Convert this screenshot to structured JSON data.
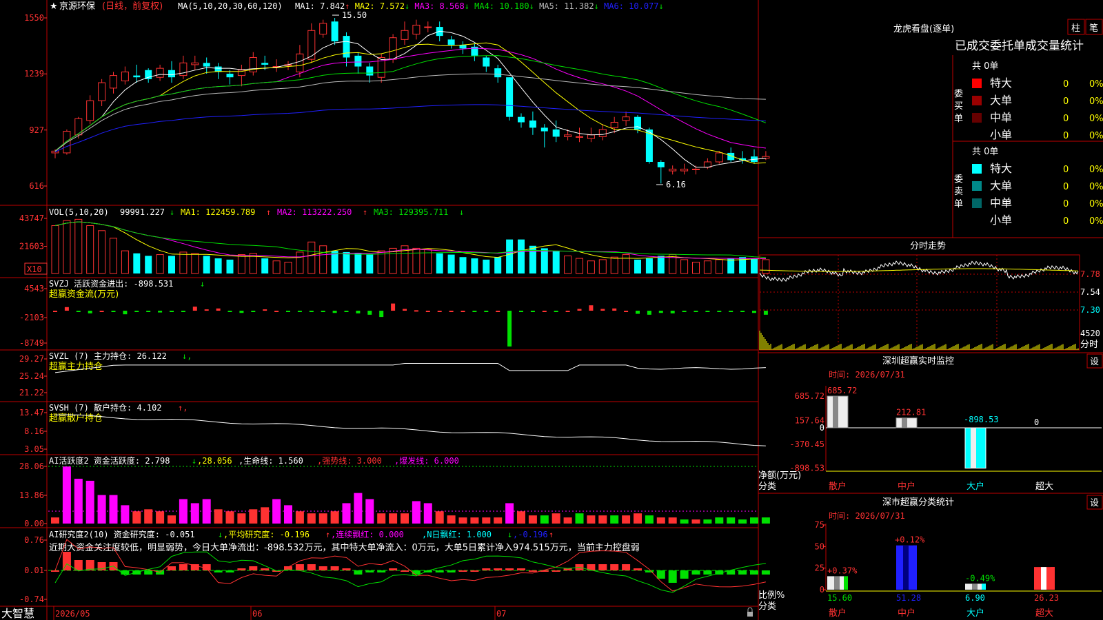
{
  "app": {
    "bottom_left": "大智慧",
    "bottom_right_icon": "lock-icon"
  },
  "colors": {
    "up": "#ff3232",
    "down": "#00ffff",
    "grid": "#c00000",
    "green": "#00e000",
    "yellow": "#ffff00",
    "magenta": "#ff00ff",
    "white": "#ffffff",
    "blue": "#2020ff",
    "grey": "#bbbbbb"
  },
  "main": {
    "title_star": "★",
    "stock_name": "京源环保",
    "period": "(日线，前复权)",
    "ma_label": "MA(5,10,20,30,60,120)",
    "mas": [
      {
        "label": "MA1:",
        "value": "7.842",
        "arrow": "↑",
        "color": "#ffffff"
      },
      {
        "label": "MA2:",
        "value": "7.572",
        "arrow": "↓",
        "color": "#ffff00"
      },
      {
        "label": "MA3:",
        "value": "8.568",
        "arrow": "↓",
        "color": "#ff00ff"
      },
      {
        "label": "MA4:",
        "value": "10.180",
        "arrow": "↓",
        "color": "#00e000"
      },
      {
        "label": "MA5:",
        "value": "11.382",
        "arrow": "↓",
        "color": "#bbbbbb"
      },
      {
        "label": "MA6:",
        "value": "10.077",
        "arrow": "↓",
        "color": "#2020ff"
      }
    ],
    "y_ticks": [
      "1550",
      "1239",
      "927",
      "616"
    ],
    "high_label": "15.50",
    "low_label": "6.16"
  },
  "chart_data": [
    {
      "type": "candlestick",
      "title": "京源环保(日线，前复权)",
      "x_labels": [
        "2026/05",
        "06",
        "07"
      ],
      "ylim": [
        5.3,
        15.6
      ],
      "y_ticks": [
        15.5,
        12.39,
        9.27,
        6.16
      ],
      "candles": [
        [
          8.0,
          8.1,
          7.7,
          8.2
        ],
        [
          8.0,
          9.2,
          7.9,
          9.3
        ],
        [
          9.0,
          9.9,
          8.8,
          10.0
        ],
        [
          9.8,
          10.9,
          9.6,
          11.2
        ],
        [
          10.9,
          11.9,
          10.6,
          12.1
        ],
        [
          11.6,
          12.3,
          11.3,
          12.5
        ],
        [
          12.0,
          12.5,
          11.8,
          12.8
        ],
        [
          12.3,
          12.2,
          11.9,
          12.9
        ],
        [
          12.6,
          12.1,
          11.9,
          12.7
        ],
        [
          12.2,
          12.7,
          12.0,
          12.9
        ],
        [
          12.6,
          12.2,
          11.9,
          13.1
        ],
        [
          12.3,
          13.0,
          12.1,
          13.4
        ],
        [
          12.9,
          13.0,
          12.6,
          13.4
        ],
        [
          13.0,
          12.8,
          12.4,
          13.3
        ],
        [
          12.8,
          12.5,
          12.1,
          13.0
        ],
        [
          12.4,
          12.2,
          11.8,
          12.6
        ],
        [
          12.3,
          12.6,
          11.7,
          12.9
        ],
        [
          12.5,
          13.3,
          12.3,
          13.6
        ],
        [
          13.0,
          12.9,
          12.6,
          13.4
        ],
        [
          12.8,
          12.8,
          12.5,
          13.2
        ],
        [
          12.9,
          12.9,
          12.6,
          13.1
        ],
        [
          12.5,
          13.5,
          12.2,
          14.0
        ],
        [
          13.2,
          14.8,
          13.0,
          15.2
        ],
        [
          14.6,
          15.2,
          14.4,
          15.4
        ],
        [
          15.3,
          14.2,
          14.0,
          15.5
        ],
        [
          14.5,
          13.3,
          12.8,
          14.7
        ],
        [
          13.4,
          12.8,
          12.4,
          13.6
        ],
        [
          12.8,
          12.3,
          11.9,
          13.0
        ],
        [
          12.2,
          13.3,
          11.9,
          13.5
        ],
        [
          13.2,
          14.4,
          13.0,
          14.6
        ],
        [
          14.3,
          14.8,
          14.0,
          15.3
        ],
        [
          14.6,
          15.1,
          14.3,
          15.4
        ],
        [
          15.0,
          15.0,
          14.7,
          15.3
        ],
        [
          15.0,
          14.5,
          14.2,
          15.3
        ],
        [
          14.3,
          14.0,
          13.8,
          14.5
        ],
        [
          14.0,
          13.8,
          13.5,
          14.2
        ],
        [
          13.9,
          13.4,
          13.1,
          14.1
        ],
        [
          13.3,
          12.8,
          12.5,
          13.4
        ],
        [
          12.7,
          12.2,
          11.9,
          12.9
        ],
        [
          12.2,
          10.0,
          9.8,
          12.2
        ],
        [
          10.0,
          9.7,
          9.4,
          10.2
        ],
        [
          9.8,
          9.4,
          9.0,
          10.3
        ],
        [
          9.4,
          9.2,
          8.3,
          9.6
        ],
        [
          9.3,
          8.9,
          8.6,
          9.8
        ],
        [
          8.9,
          9.0,
          8.7,
          9.3
        ],
        [
          8.9,
          8.9,
          8.6,
          9.4
        ],
        [
          8.8,
          9.0,
          8.6,
          9.4
        ],
        [
          8.9,
          9.3,
          8.7,
          9.6
        ],
        [
          9.4,
          9.7,
          9.1,
          10.0
        ],
        [
          9.8,
          10.0,
          9.5,
          10.3
        ],
        [
          10.0,
          9.3,
          9.1,
          10.1
        ],
        [
          9.3,
          7.5,
          7.4,
          9.4
        ],
        [
          7.5,
          7.2,
          6.3,
          7.6
        ],
        [
          7.0,
          7.1,
          6.8,
          7.3
        ],
        [
          7.0,
          7.1,
          6.8,
          7.4
        ],
        [
          7.1,
          7.1,
          6.8,
          7.3
        ],
        [
          7.2,
          7.5,
          7.1,
          7.7
        ],
        [
          7.5,
          8.0,
          7.4,
          8.1
        ],
        [
          8.0,
          7.6,
          7.5,
          8.3
        ],
        [
          7.7,
          7.6,
          7.4,
          8.1
        ],
        [
          7.8,
          7.5,
          7.4,
          8.2
        ],
        [
          7.7,
          7.8,
          7.6,
          8.1
        ]
      ],
      "series": [
        {
          "name": "MA1",
          "value": 7.842
        },
        {
          "name": "MA2",
          "value": 7.572
        },
        {
          "name": "MA3",
          "value": 8.568
        },
        {
          "name": "MA4",
          "value": 10.18
        },
        {
          "name": "MA5",
          "value": 11.382
        },
        {
          "name": "MA6",
          "value": 10.077
        }
      ],
      "annotations": [
        "15.50",
        "6.16"
      ]
    },
    {
      "type": "bar",
      "title": "VOL(5,10,20)",
      "ylim": [
        0,
        45000
      ],
      "y_ticks": [
        43747,
        21603
      ],
      "unit": "X10",
      "values": [
        38000,
        42000,
        43000,
        38000,
        34000,
        28000,
        18000,
        16000,
        14000,
        15000,
        14000,
        17000,
        16000,
        14000,
        12000,
        11000,
        15000,
        16000,
        12000,
        10000,
        9000,
        17000,
        25000,
        22000,
        18000,
        17000,
        16000,
        15000,
        18000,
        20000,
        22000,
        20000,
        19000,
        16000,
        15000,
        13000,
        12000,
        11000,
        13000,
        27000,
        27000,
        22000,
        20000,
        18000,
        14000,
        12000,
        10000,
        11000,
        13000,
        15000,
        11000,
        12000,
        14000,
        15000,
        11000,
        9000,
        10000,
        11000,
        12000,
        13000,
        12000,
        11000
      ],
      "readouts": [
        "99991.227",
        "122459.789",
        "113222.250",
        "129395.711"
      ]
    },
    {
      "type": "bar",
      "title": "SVZJ 活跃资金进出",
      "ylim": [
        -8749,
        4543
      ],
      "y_ticks": [
        4543,
        -2103,
        -8749
      ],
      "value": -898.531
    },
    {
      "type": "line",
      "title": "SVZL (7) 主力持仓",
      "ylim": [
        21.22,
        29.27
      ],
      "y_ticks": [
        29.27,
        25.24,
        21.22
      ],
      "value": 26.122
    },
    {
      "type": "line",
      "title": "SVSH (7) 散户持仓",
      "ylim": [
        3.05,
        13.47
      ],
      "y_ticks": [
        13.47,
        8.16,
        3.05
      ],
      "value": 4.102
    },
    {
      "type": "bar",
      "title": "AI活跃度2 资金活跃度",
      "ylim": [
        0,
        28.06
      ],
      "y_ticks": [
        28.06,
        13.86,
        0.0
      ],
      "readouts": [
        "2.798",
        "28.056",
        "1.560",
        "3.000",
        "6.000"
      ]
    },
    {
      "type": "bar",
      "title": "AI研究度2(10) 资金研究度",
      "ylim": [
        -0.74,
        0.76
      ],
      "y_ticks": [
        0.76,
        0.01,
        -0.74
      ],
      "readouts": [
        "-0.051",
        "-0.196",
        "0.000",
        "1.000",
        "-0.196"
      ]
    },
    {
      "type": "bar",
      "title": "深圳超赢实时监控",
      "categories": [
        "散户",
        "中户",
        "大户",
        "超大"
      ],
      "values": [
        685.72,
        212.81,
        -898.53,
        0
      ],
      "y_ticks": [
        685.72,
        157.64,
        0,
        -370.45,
        -898.53
      ],
      "ylabel": "净额(万元)"
    },
    {
      "type": "bar",
      "title": "深市超赢分类统计",
      "categories": [
        "散户",
        "中户",
        "大户",
        "超大"
      ],
      "values": [
        15.6,
        51.28,
        6.9,
        26.23
      ],
      "changes": [
        "+0.37%",
        "+0.12%",
        "-0.49%",
        ""
      ],
      "y_ticks": [
        75,
        50,
        25,
        0
      ],
      "ylabel": "比例%"
    }
  ],
  "vol": {
    "label": "VOL(5,10,20)",
    "v": "99991.227",
    "v_arrow": "↓",
    "ma1": "MA1: 122459.789",
    "ma1_arrow": "↑",
    "ma2": "MA2: 113222.250",
    "ma2_arrow": "↑",
    "ma3": "MA3: 129395.711",
    "ma3_arrow": "↓",
    "ticks": [
      "43747",
      "21603"
    ],
    "unit": "X10"
  },
  "svzj": {
    "label": "SVZJ  活跃资金进出: -898.531",
    "arrow": "↓",
    "sub": "超赢资金流(万元)",
    "ticks": [
      "4543",
      "-2103",
      "-8749"
    ]
  },
  "svzl": {
    "label": "SVZL (7) 主力持仓: 26.122",
    "arrow": "↓,",
    "sub": "超赢主力持仓",
    "ticks": [
      "29.27",
      "25.24",
      "21.22"
    ]
  },
  "svsh": {
    "label": "SVSH (7) 散户持仓: 4.102",
    "arrow": "↑,",
    "sub": "超赢散户持仓",
    "ticks": [
      "13.47",
      "8.16",
      "3.05"
    ]
  },
  "ai_act": {
    "p1": "AI活跃度2 资金活跃度: 2.798",
    "p1_arrow": "↓",
    "p2": ",28.056",
    "p3": ",生命线: 1.560",
    "p4": ",强势线: 3.000",
    "p5": ",爆发线: 6.000",
    "ticks": [
      "28.06",
      "13.86",
      "0.00"
    ]
  },
  "ai_res": {
    "p1": "AI研究度2(10) 资金研究度: -0.051",
    "p1_arrow": "↓",
    "p2": ",平均研究度: -0.196",
    "p2_arrow": "↑",
    "p3": ",连续飘红: 0.000",
    "p4": ",N日飘红: 1.000",
    "p4_arrow": "↓",
    "p5": ",-0.196",
    "p5_arrow": "↑",
    "note": "近期大资金关注度较低，明显弱势，今日大单净流出：-898.532万元，其中特大单净流入：0万元，大单5日累计净入974.515万元，当前主力控盘弱",
    "ticks": [
      "0.76",
      "0.01",
      "-0.74"
    ]
  },
  "xaxis": {
    "labels": [
      "2026/05",
      "06",
      "07"
    ]
  },
  "lhb": {
    "title": "龙虎看盘(逐单)",
    "btn1": "柱",
    "btn2": "笔",
    "subtitle": "已成交委托单成交量统计",
    "buy": {
      "side": "委买单",
      "total": "共 0单",
      "rows": [
        {
          "label": "特大",
          "color": "#ff0000",
          "v": "0",
          "p": "0%"
        },
        {
          "label": "大单",
          "color": "#990000",
          "v": "0",
          "p": "0%"
        },
        {
          "label": "中单",
          "color": "#660000",
          "v": "0",
          "p": "0%"
        },
        {
          "label": "小单",
          "color": "",
          "v": "0",
          "p": "0%"
        }
      ]
    },
    "sell": {
      "side": "委卖单",
      "total": "共 0单",
      "rows": [
        {
          "label": "特大",
          "color": "#00ffff",
          "v": "0",
          "p": "0%"
        },
        {
          "label": "大单",
          "color": "#008888",
          "v": "0",
          "p": "0%"
        },
        {
          "label": "中单",
          "color": "#006666",
          "v": "0",
          "p": "0%"
        },
        {
          "label": "小单",
          "color": "",
          "v": "0",
          "p": "0%"
        }
      ]
    }
  },
  "intraday": {
    "title": "分时走势",
    "ticks": [
      "7.78",
      "7.54",
      "7.30"
    ],
    "vol_tick": "4520",
    "unit": "分时"
  },
  "sz_monitor": {
    "title": "深圳超赢实时监控",
    "btn": "设",
    "time": "时间: 2026/07/31",
    "ticks": [
      "685.72",
      "157.64",
      "0",
      "-370.45",
      "-898.53"
    ],
    "ylabel": "净额(万元)",
    "xlabel": "分类",
    "cats": [
      "散户",
      "中户",
      "大户",
      "超大"
    ],
    "value_labels": [
      "685.72",
      "212.81",
      "-898.53",
      "0"
    ]
  },
  "sz_class": {
    "title": "深市超赢分类统计",
    "btn": "设",
    "time": "时间: 2026/07/31",
    "ticks": [
      "75",
      "50",
      "25",
      "0"
    ],
    "ylabel": "比例%",
    "xlabel": "分类",
    "cats": [
      "散户",
      "中户",
      "大户",
      "超大"
    ],
    "pct": [
      "15.60",
      "51.28",
      "6.90",
      "26.23"
    ],
    "chg": [
      "+0.37%",
      "+0.12%",
      "-0.49%",
      ""
    ]
  }
}
